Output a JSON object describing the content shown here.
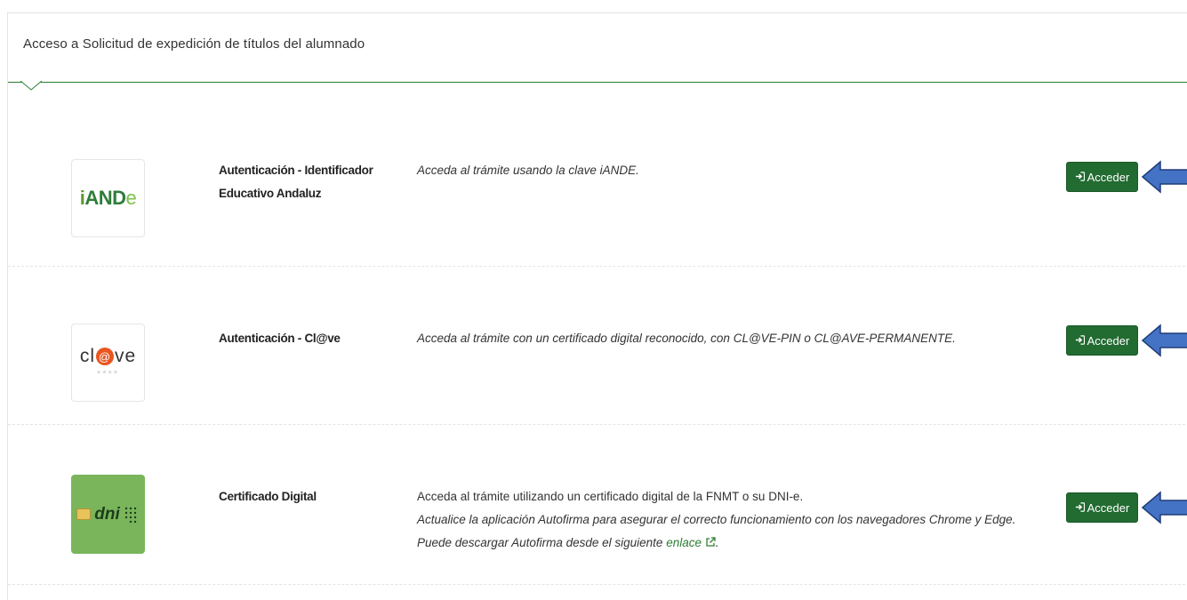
{
  "panel": {
    "title": "Acceso a Solicitud de expedición de títulos del alumnado"
  },
  "methods": [
    {
      "logo": {
        "icon": "iande-logo",
        "parts": [
          "i",
          "AND",
          "e"
        ]
      },
      "title_line1": "Autenticación - Identificador",
      "title_line2": "Educativo Andaluz",
      "description": "Acceda al trámite usando la clave iANDE.",
      "button_label": "Acceder"
    },
    {
      "logo": {
        "icon": "clave-logo",
        "prefix": "cl",
        "at": "@",
        "suffix": "ve",
        "stars": "****"
      },
      "title_line1": "Autenticación - Cl@ve",
      "description": "Acceda al trámite con un certificado digital reconocido, con CL@VE-PIN o CL@AVE-PERMANENTE.",
      "button_label": "Acceder"
    },
    {
      "logo": {
        "icon": "dni-logo",
        "text": "dni"
      },
      "title_line1": "Certificado Digital",
      "description_line1": "Acceda al trámite utilizando un certificado digital de la FNMT o su DNI-e.",
      "description_line2": "Actualice la aplicación Autofirma para asegurar el correcto funcionamiento con los navegadores Chrome y Edge.",
      "description_line3_prefix": "Puede descargar Autofirma desde el siguiente",
      "description_link": "enlace",
      "description_line3_suffix": ".",
      "button_label": "Acceder"
    }
  ],
  "colors": {
    "accent": "#226b31",
    "arrow_fill": "#4472c4",
    "arrow_stroke": "#1f3c7a",
    "link": "#2e7d32"
  },
  "icons": {
    "button": "sign-in-icon",
    "external": "external-link-icon",
    "annotation": "left-arrow-icon"
  }
}
